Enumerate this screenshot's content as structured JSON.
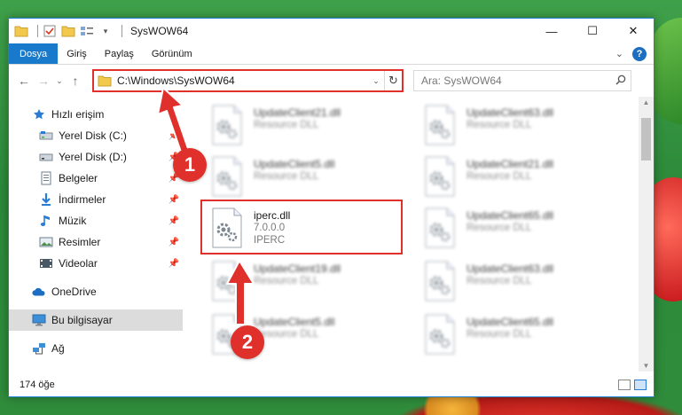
{
  "window": {
    "title": "SysWOW64",
    "controls": [
      "—",
      "☐",
      "✕"
    ]
  },
  "ribbon": {
    "tabs": [
      "Dosya",
      "Giriş",
      "Paylaş",
      "Görünüm"
    ]
  },
  "address": {
    "path": "C:\\Windows\\SysWOW64",
    "search_placeholder": "Ara: SysWOW64"
  },
  "nav": {
    "items": [
      {
        "label": "Hızlı erişim",
        "icon": "star-icon",
        "pinned": false
      },
      {
        "label": "Yerel Disk (C:)",
        "icon": "drive-icon",
        "pinned": true
      },
      {
        "label": "Yerel Disk (D:)",
        "icon": "drive-icon",
        "pinned": true
      },
      {
        "label": "Belgeler",
        "icon": "documents-icon",
        "pinned": true
      },
      {
        "label": "İndirmeler",
        "icon": "download-icon",
        "pinned": true
      },
      {
        "label": "Müzik",
        "icon": "music-icon",
        "pinned": true
      },
      {
        "label": "Resimler",
        "icon": "pictures-icon",
        "pinned": true
      },
      {
        "label": "Videolar",
        "icon": "video-icon",
        "pinned": true
      },
      {
        "label": "OneDrive",
        "icon": "cloud-icon",
        "pinned": false
      },
      {
        "label": "Bu bilgisayar",
        "icon": "computer-icon",
        "pinned": false
      },
      {
        "label": "Ağ",
        "icon": "network-icon",
        "pinned": false
      }
    ]
  },
  "files": [
    {
      "name": "UpdateClient21.dll",
      "line2": "Resource DLL",
      "line3": ""
    },
    {
      "name": "UpdateClient63.dll",
      "line2": "Resource DLL",
      "line3": ""
    },
    {
      "name": "UpdateClient5.dll",
      "line2": "Resource DLL",
      "line3": ""
    },
    {
      "name": "UpdateClient21.dll",
      "line2": "Resource DLL",
      "line3": ""
    },
    {
      "name": "iperc.dll",
      "line2": "7.0.0.0",
      "line3": "IPERC"
    },
    {
      "name": "UpdateClient65.dll",
      "line2": "Resource DLL",
      "line3": ""
    },
    {
      "name": "UpdateClient19.dll",
      "line2": "Resource DLL",
      "line3": ""
    },
    {
      "name": "UpdateClient63.dll",
      "line2": "Resource DLL",
      "line3": ""
    },
    {
      "name": "UpdateClient5.dll",
      "line2": "Resource DLL",
      "line3": ""
    },
    {
      "name": "UpdateClient65.dll",
      "line2": "Resource DLL",
      "line3": ""
    }
  ],
  "status": {
    "count": "174 öğe"
  },
  "callouts": {
    "one": "1",
    "two": "2",
    "color": "#e0302c"
  }
}
